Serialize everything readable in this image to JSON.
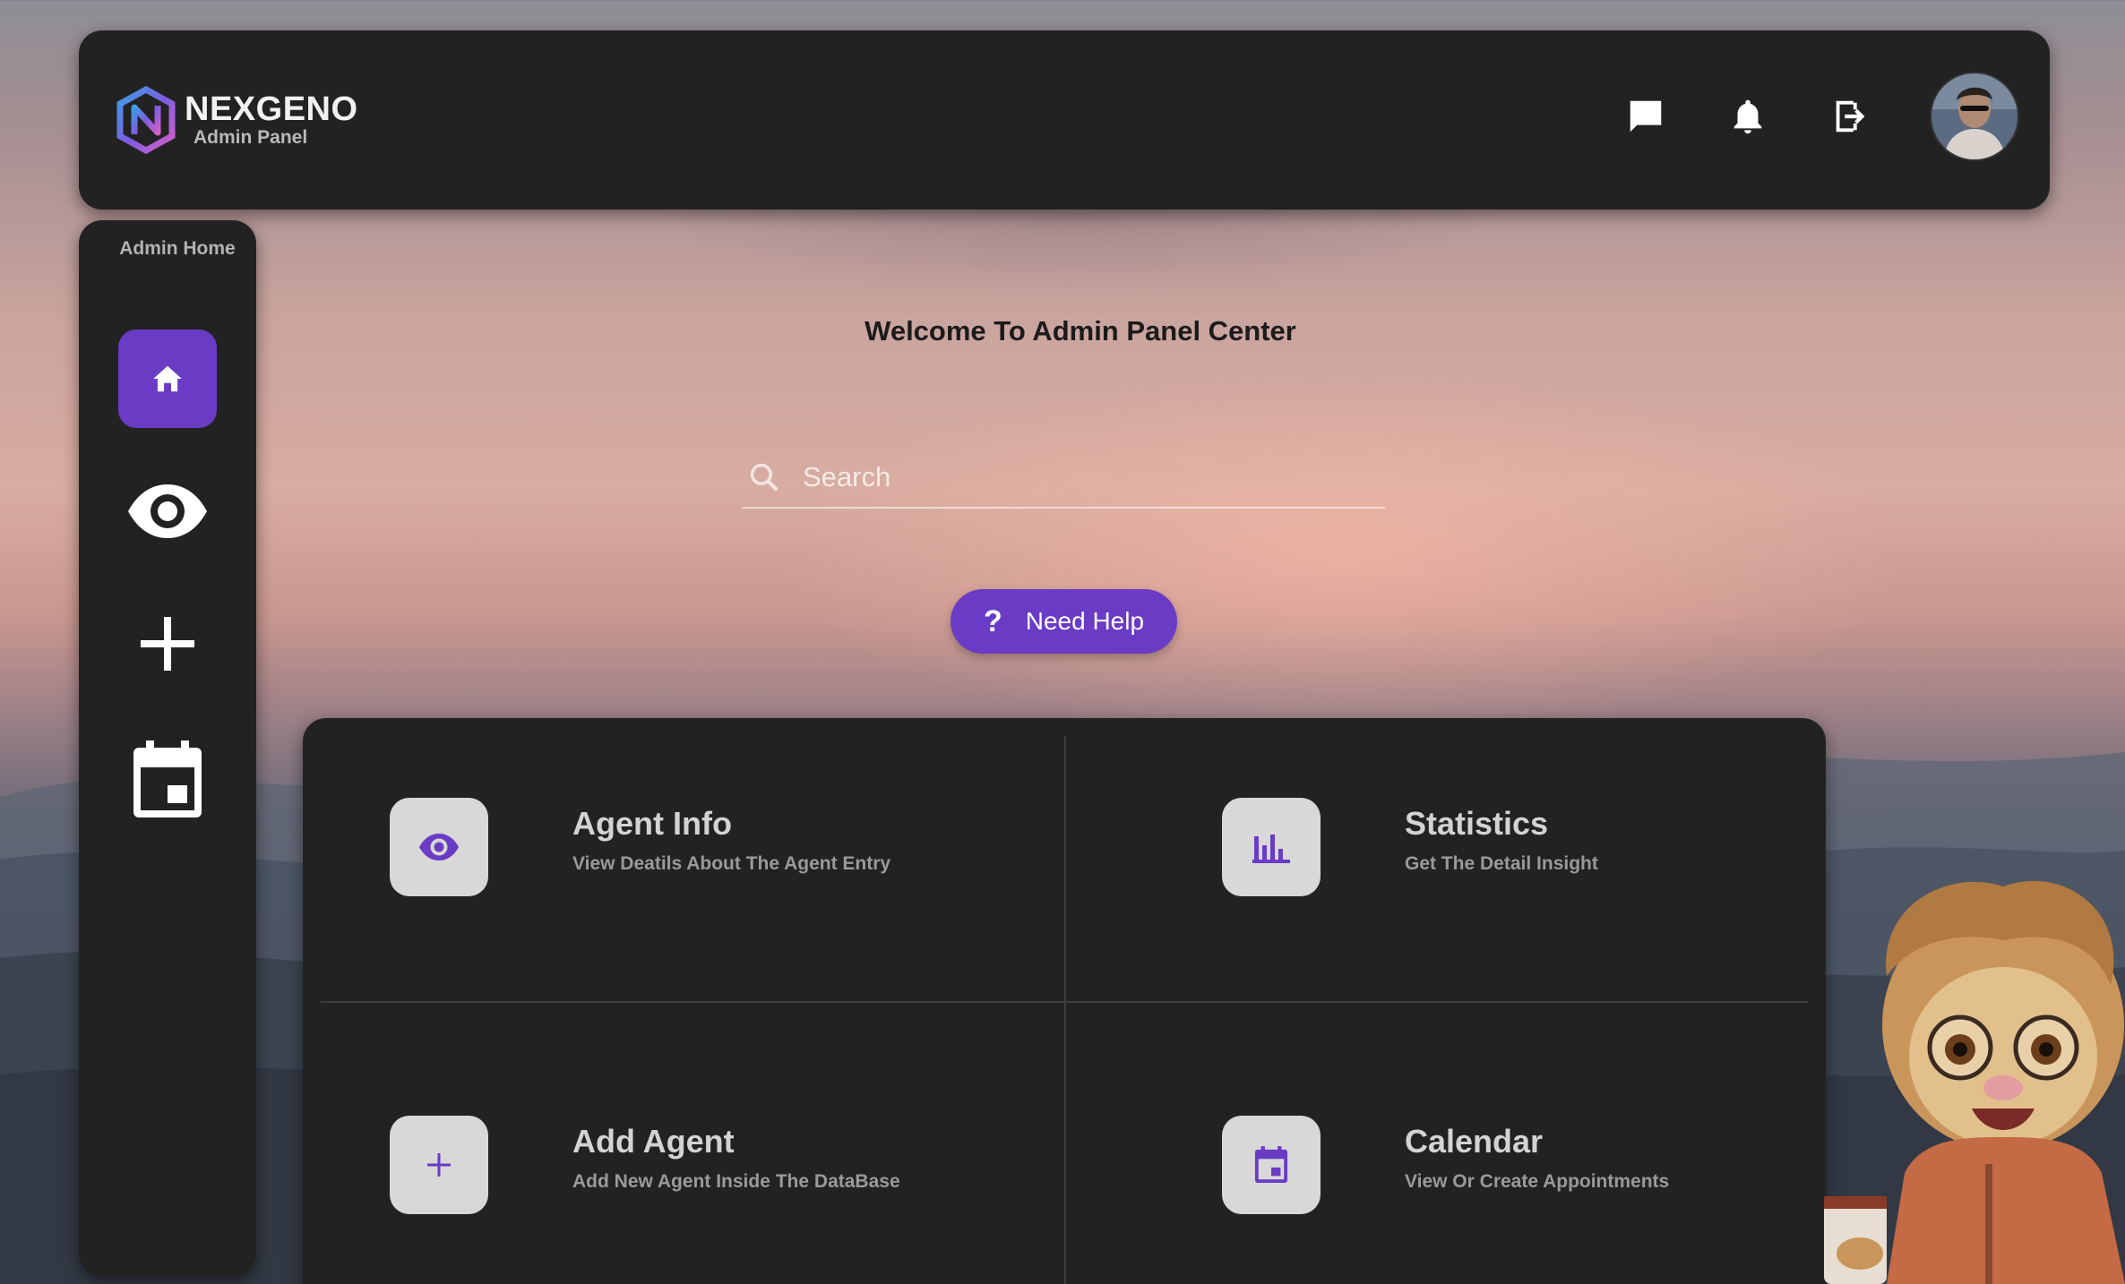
{
  "brand": {
    "name": "NEXGENO",
    "subtitle": "Admin Panel"
  },
  "header": {
    "icons": [
      "chat-icon",
      "bell-icon",
      "logout-icon"
    ],
    "avatar": "user-avatar"
  },
  "sidebar": {
    "title": "Admin Home",
    "items": [
      {
        "icon": "home-icon",
        "active": true
      },
      {
        "icon": "eye-icon",
        "active": false
      },
      {
        "icon": "plus-icon",
        "active": false
      },
      {
        "icon": "calendar-icon",
        "active": false
      }
    ]
  },
  "main": {
    "welcome": "Welcome To Admin Panel Center",
    "search": {
      "placeholder": "Search",
      "value": ""
    },
    "help_label": "Need Help",
    "help_icon": "?"
  },
  "cards": [
    {
      "title": "Agent Info",
      "desc": "View Deatils About The Agent Entry",
      "icon": "eye-icon"
    },
    {
      "title": "Statistics",
      "desc": "Get The Detail Insight",
      "icon": "bar-chart-icon"
    },
    {
      "title": "Add Agent",
      "desc": "Add New Agent Inside The DataBase",
      "icon": "plus-icon"
    },
    {
      "title": "Calendar",
      "desc": "View Or Create Appointments",
      "icon": "calendar-icon"
    }
  ],
  "colors": {
    "accent": "#6a3bc4",
    "panel": "#222222",
    "card_icon_bg": "#d8d8d8"
  }
}
